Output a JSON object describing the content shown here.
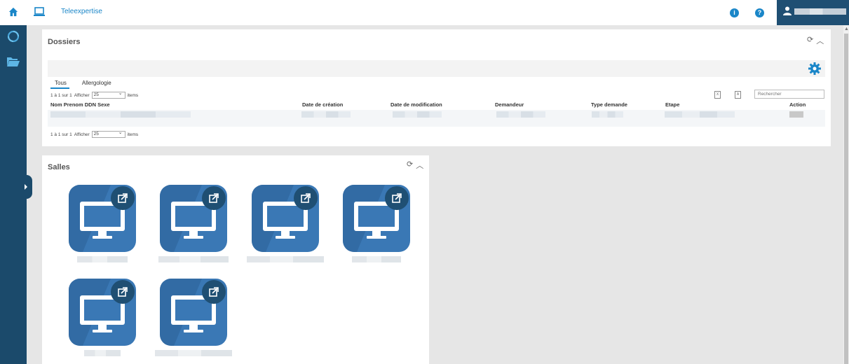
{
  "topbar": {
    "link_label": "Teleexpertise",
    "info_label": "i",
    "help_label": "?",
    "brand_color": "#1a86c8",
    "user_bg": "#1f4f73"
  },
  "sidebar": {
    "color": "#1b4a6b"
  },
  "dossiers": {
    "title": "Dossiers",
    "tabs": [
      {
        "label": "Tous",
        "active": true
      },
      {
        "label": "Allergologie",
        "active": false
      }
    ],
    "pager_top": {
      "range": "1 à 1 sur 1",
      "show_label": "Afficher",
      "page_size": "25",
      "items_label": "items"
    },
    "pager_bottom": {
      "range": "1 à 1 sur 1",
      "show_label": "Afficher",
      "page_size": "25",
      "items_label": "items"
    },
    "search_placeholder": "Rechercher",
    "columns": [
      "Nom Prenom DDN Sexe",
      "Date de création",
      "Date de modification",
      "Demandeur",
      "Type demande",
      "Etape",
      "Action"
    ],
    "export_icons": [
      "excel-export-icon",
      "pdf-export-icon"
    ]
  },
  "salles": {
    "title": "Salles",
    "rooms_count": 6,
    "tile_color": "#3a78b5"
  }
}
